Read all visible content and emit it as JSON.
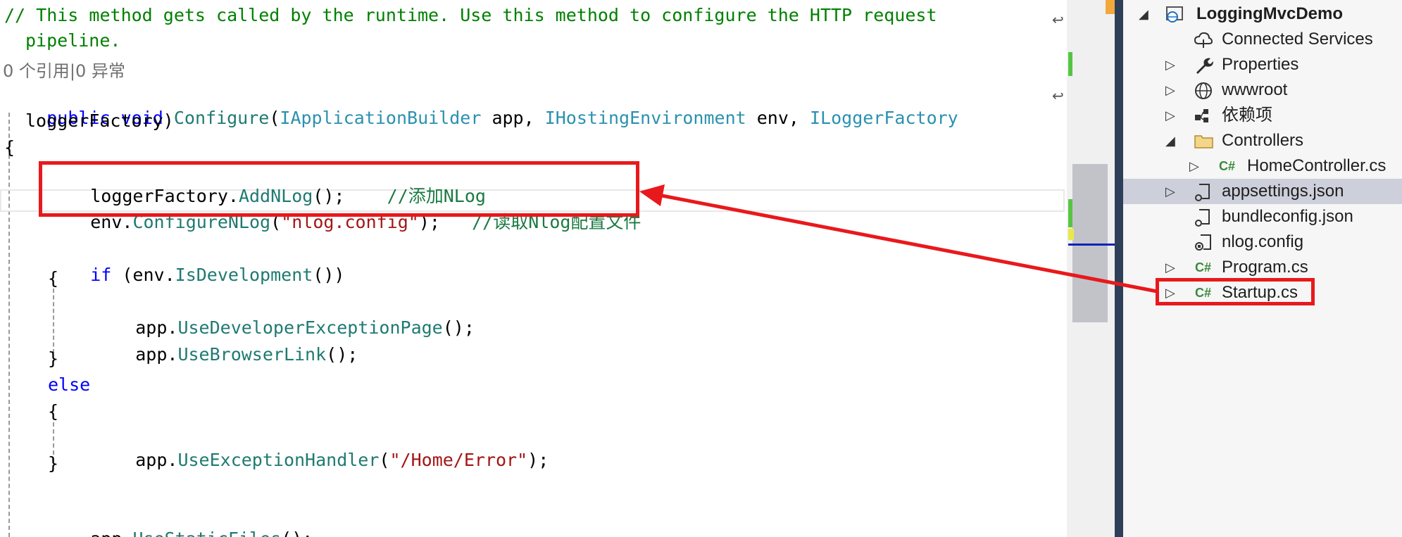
{
  "editor": {
    "comment_line1": "// This method gets called by the runtime. Use this method to configure the HTTP request",
    "comment_line2": "pipeline.",
    "codelens": "0 个引用|0 异常",
    "sig": {
      "kw1": "public",
      "kw2": "void",
      "method": "Configure",
      "p1type": "IApplicationBuilder",
      "p1name": " app, ",
      "p2type": "IHostingEnvironment",
      "p2name": " env, ",
      "p3type": "ILoggerFactory",
      "cont": "loggerFactory)"
    },
    "open_brace": "{",
    "l_addnlog": {
      "obj": "loggerFactory.",
      "method": "AddNLog",
      "tail": "();    ",
      "comment": "//添加NLog"
    },
    "l_confnlog": {
      "obj": "env.",
      "method": "ConfigureNLog",
      "paren": "(",
      "str": "\"nlog.config\"",
      "tail": ");   ",
      "comment": "//读取Nlog配置文件"
    },
    "l_if": {
      "kw": "if",
      "open": " (env.",
      "method": "IsDevelopment",
      "tail": "())"
    },
    "l_brace1": "{",
    "l_devpage": {
      "obj": "app.",
      "method": "UseDeveloperExceptionPage",
      "tail": "();"
    },
    "l_browser": {
      "obj": "app.",
      "method": "UseBrowserLink",
      "tail": "();"
    },
    "l_brace2": "}",
    "l_else": "else",
    "l_brace3": "{",
    "l_exhandler": {
      "obj": "app.",
      "method": "UseExceptionHandler",
      "paren": "(",
      "str": "\"/Home/Error\"",
      "tail": ");"
    },
    "l_brace4": "}",
    "l_static": {
      "obj": "app.",
      "method": "UseStaticFiles",
      "tail": "();"
    },
    "wrap_glyph": "↩"
  },
  "explorer": {
    "items": [
      {
        "label": "LoggingMvcDemo",
        "icon": "web-project-icon",
        "expander": "◢"
      },
      {
        "label": "Connected Services",
        "icon": "cloud-icon"
      },
      {
        "label": "Properties",
        "icon": "wrench-icon",
        "expander": "▷"
      },
      {
        "label": "wwwroot",
        "icon": "globe-icon",
        "expander": "▷"
      },
      {
        "label": "依赖项",
        "icon": "dependencies-icon",
        "expander": "▷"
      },
      {
        "label": "Controllers",
        "icon": "folder-icon",
        "expander": "◢"
      },
      {
        "label": "HomeController.cs",
        "icon": "csharp-icon",
        "expander": "▷"
      },
      {
        "label": "appsettings.json",
        "icon": "json-icon",
        "expander": "▷"
      },
      {
        "label": "bundleconfig.json",
        "icon": "json-icon"
      },
      {
        "label": "nlog.config",
        "icon": "config-icon"
      },
      {
        "label": "Program.cs",
        "icon": "csharp-icon",
        "expander": "▷"
      },
      {
        "label": "Startup.cs",
        "icon": "csharp-icon",
        "expander": "▷"
      }
    ],
    "csharp_glyph": "C#"
  },
  "colors": {
    "annotation": "#e8191c",
    "selection": "#cdd0da",
    "splitter": "#2e3f59"
  }
}
